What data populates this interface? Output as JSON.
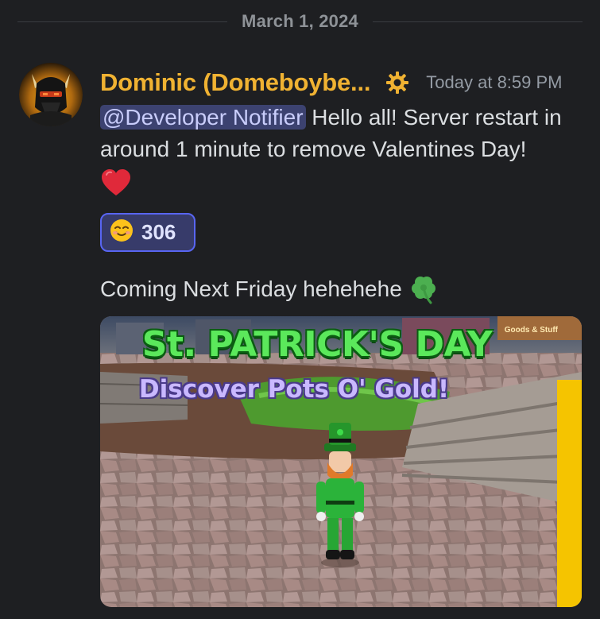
{
  "divider": {
    "date": "March 1, 2024"
  },
  "message": {
    "author": "Dominic (Domeboybe...",
    "timestamp": "Today at 8:59 PM",
    "mention": "@Developer Notifier",
    "text": " Hello all! Server restart in around 1 minute to remove Valentines Day!",
    "emoji": "heart-icon"
  },
  "reaction": {
    "emoji": "smiling-face-icon",
    "count": "306"
  },
  "message2": {
    "text": "Coming Next Friday hehehehe",
    "emoji": "four-leaf-clover-icon"
  },
  "attachment": {
    "title": "St. PATRICK'S DAY",
    "subtitle": "Discover Pots O' Gold!",
    "sign": "Goods & Stuff"
  },
  "colors": {
    "background": "#1e1f22",
    "author": "#f0b232",
    "mention_bg": "#3c4270",
    "reaction_border": "#5865f2"
  }
}
